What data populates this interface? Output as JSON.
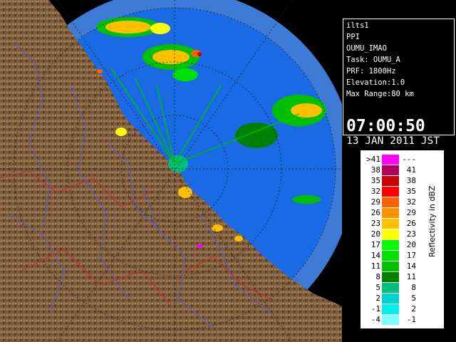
{
  "info": {
    "lines": [
      "ilts1",
      "PPI",
      "OUMU_IMAO",
      "Task: OUMU_A",
      "PRF: 1800Hz",
      "Elevation:1.0",
      "Max Range:80 km"
    ],
    "time": "07:00:50",
    "date": "13 JAN 2011 JST"
  },
  "scale": {
    "unit": "Reflectivity in dBZ",
    "left_labels": [
      ">41",
      "38",
      "35",
      "32",
      "29",
      "26",
      "23",
      "20",
      "17",
      "14",
      "11",
      "8",
      "5",
      "2",
      "-1",
      "-4"
    ],
    "right_labels": [
      "---",
      "41",
      "38",
      "35",
      "32",
      "29",
      "26",
      "23",
      "20",
      "17",
      "14",
      "11",
      "8",
      "5",
      "2",
      "-1"
    ],
    "colors": [
      "#ff00ff",
      "#b00060",
      "#c80000",
      "#ff0000",
      "#ff6000",
      "#ff9000",
      "#ffc000",
      "#ffff00",
      "#00ff00",
      "#00e000",
      "#00c000",
      "#008000",
      "#00c080",
      "#00d0d0",
      "#00f0f0",
      "#80ffff"
    ]
  },
  "map": {
    "sea_color": "#1a73e8",
    "far_sea_color": "#4a8de0",
    "land_color": "#806040"
  }
}
